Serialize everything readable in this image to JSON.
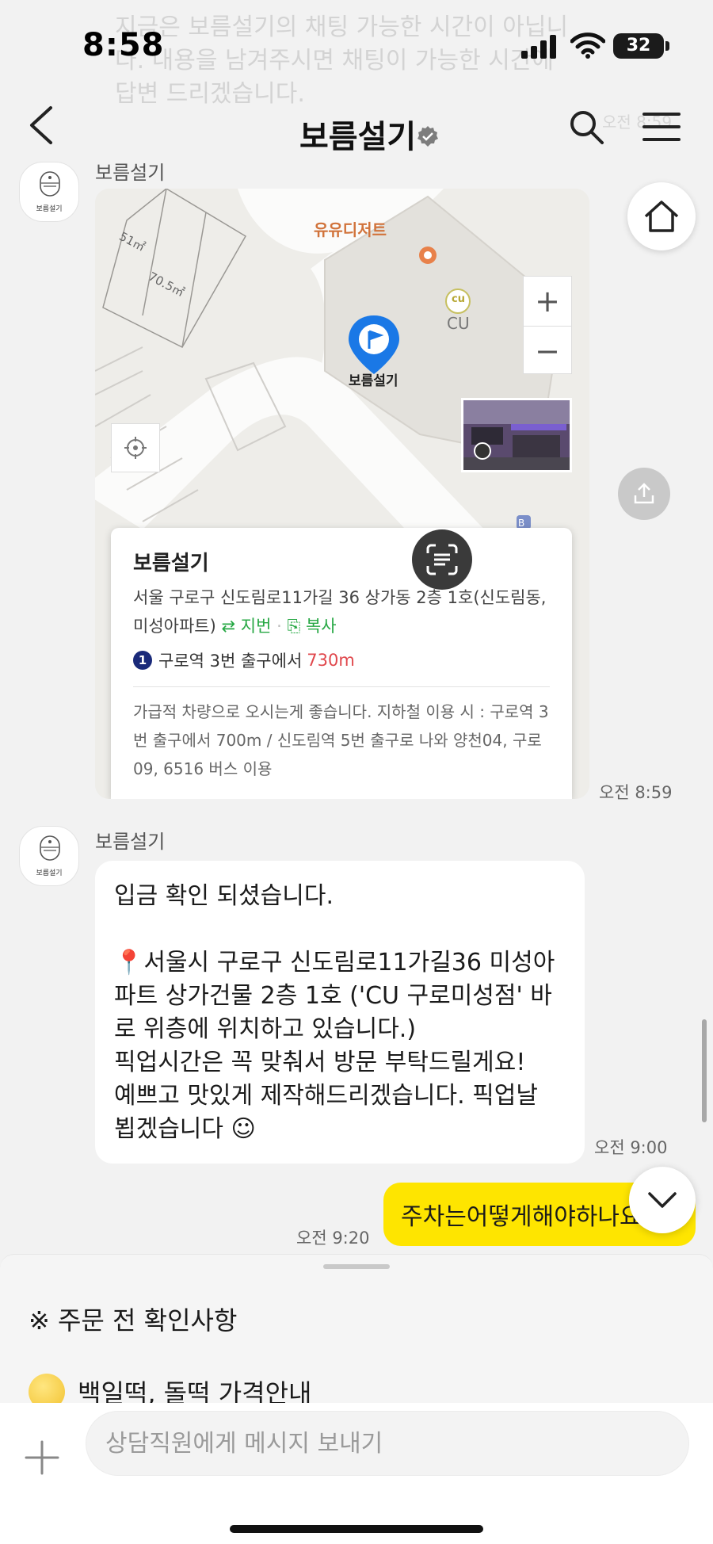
{
  "background": {
    "faded_text": "지금은 보름설기의 채팅 가능한 시간이 아닙니다. 내용을 남겨주시면 채팅이 가능한 시간에 답변 드리겠습니다.",
    "faded_time": "오전 8:59"
  },
  "status_bar": {
    "time": "8:58",
    "battery": "32"
  },
  "header": {
    "title": "보름설기",
    "verified": true,
    "back_icon": "chevron-left-icon",
    "search_icon": "search-icon",
    "menu_icon": "hamburger-icon"
  },
  "messages": {
    "sender_name": "보름설기",
    "avatar_label": "보름설기",
    "map_card": {
      "poi_dessert": "유유디저트",
      "poi_cu_logo": "cu",
      "poi_cu": "CU",
      "pin_label": "보름설기",
      "lot_area_1": "51㎡",
      "lot_area_2": "70.5㎡",
      "zoom_in": "+",
      "zoom_out": "−",
      "place_name": "보름설기",
      "address": "서울 구로구 신도림로11가길 36 상가동 2층 1호(신도림동, 미성아파트)",
      "lot_number_action": "⇄ 지번",
      "copy_action": "복사",
      "subway_line": "1",
      "subway_text": "구로역 3번 출구에서",
      "subway_distance": "730m",
      "note": "가급적 차량으로 오시는게 좋습니다. 지하철 이용 시 : 구로역 3번 출구에서 700m / 신도림역 5번 출구로 나와 양천04, 구로09, 6516 버스 이용",
      "time": "오전 8:59"
    },
    "reply": {
      "text": "입금 확인 되셨습니다.\n\n📍서울시 구로구 신도림로11가길36 미성아파트 상가건물 2층 1호 ('CU 구로미성점' 바로 위층에 위치하고 있습니다.)\n픽업시간은 꼭 맞춰서 방문 부탁드릴게요!\n예쁘고 맛있게 제작해드리겠습니다. 픽업날 뵙겠습니다 ☺",
      "time": "오전 9:00"
    },
    "mine": {
      "text": "주차는어떻게해야하나요?",
      "time": "오전 9:20"
    }
  },
  "sheet": {
    "notice": "※ 주문 전 확인사항",
    "item": "백일떡, 돌떡 가격안내"
  },
  "input": {
    "placeholder": "상담직원에게 메시지 보내기"
  },
  "colors": {
    "my_bubble": "#fee500",
    "their_bubble": "#ffffff",
    "chat_bg": "#f2f2f2",
    "link_green": "#27a844",
    "distance_red": "#e0474c"
  }
}
